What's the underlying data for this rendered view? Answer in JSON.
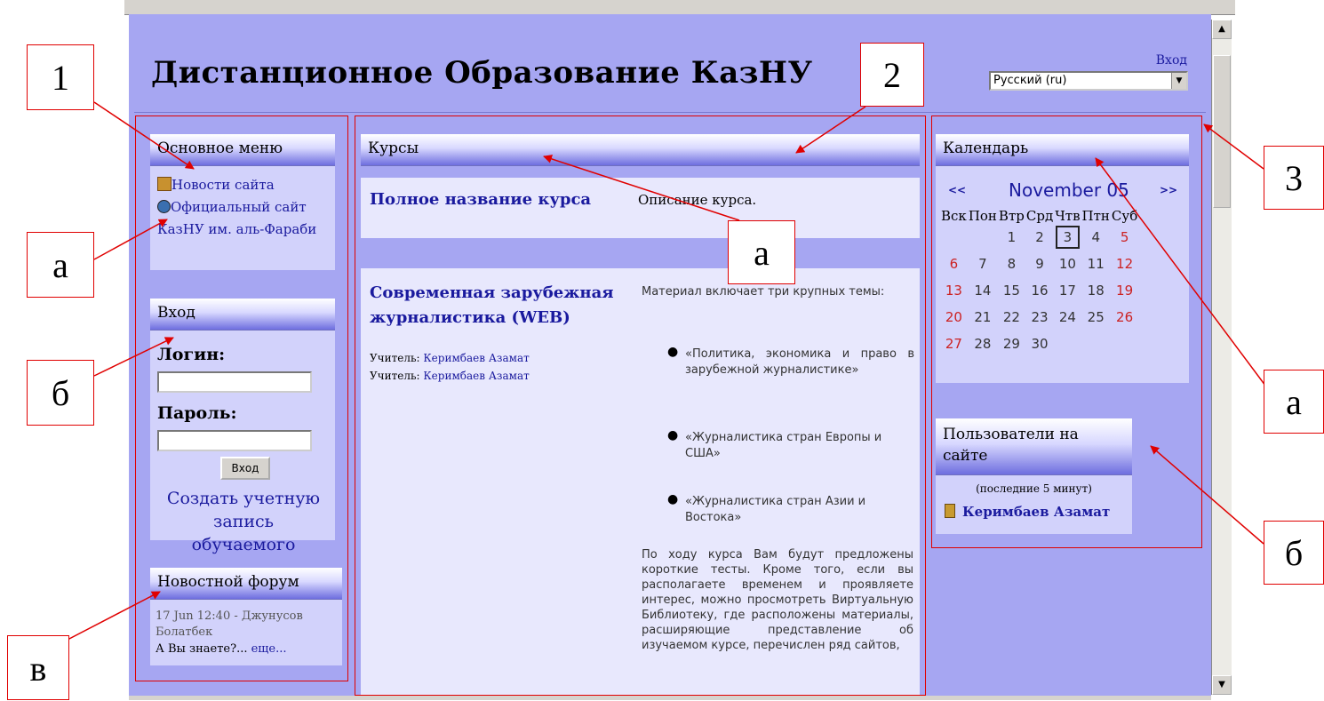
{
  "site": {
    "title": "Дистанционное Образование КазНУ",
    "login_link": "Вход",
    "language": "Русский (ru)"
  },
  "main_menu": {
    "title": "Основное меню",
    "items": [
      {
        "label": "Новости сайта",
        "icon": "news-icon"
      },
      {
        "label": "Официальный сайт КазНУ им. аль-Фараби",
        "icon": "globe-icon"
      }
    ]
  },
  "login_block": {
    "title": "Вход",
    "login_label": "Логин:",
    "password_label": "Пароль:",
    "button": "Вход",
    "signup_link": "Создать учетную запись обучаемого"
  },
  "news_forum": {
    "title": "Новостной форум",
    "post_meta": "17 Jun 12:40 - Джунусов Болатбек",
    "post_text": "А Вы знаете?...",
    "more": "еще..."
  },
  "courses": {
    "title": "Курсы",
    "list": [
      {
        "name": "Полное название курса",
        "description": "Описание курса."
      },
      {
        "name": "Современная зарубежная журналистика (WEB)",
        "teacher_label": "Учитель:",
        "teachers": [
          "Керимбаев Азамат",
          "Керимбаев Азамат"
        ],
        "intro": "Материал включает три крупных темы:",
        "topics": [
          "«Политика, экономика и право в зарубежной журналистике»",
          "«Журналистика стран Европы и США»",
          "«Журналистика стран Азии и Востока»"
        ],
        "body": "По ходу курса Вам будут предложены короткие тесты. Кроме того, если вы располагаете временем и проявляете интерес, можно просмотреть Виртуальную Библиотеку, где расположены материалы, расширяющие представление об изучаемом курсе, перечислен ряд сайтов,"
      }
    ]
  },
  "calendar": {
    "title": "Календарь",
    "prev": "<<",
    "next": ">>",
    "month": "November 05",
    "weekdays": [
      "Вск",
      "Пон",
      "Втр",
      "Срд",
      "Чтв",
      "Птн",
      "Суб"
    ],
    "weeks": [
      [
        "",
        "",
        "1",
        "2",
        "3",
        "4",
        "5"
      ],
      [
        "6",
        "7",
        "8",
        "9",
        "10",
        "11",
        "12"
      ],
      [
        "13",
        "14",
        "15",
        "16",
        "17",
        "18",
        "19"
      ],
      [
        "20",
        "21",
        "22",
        "23",
        "24",
        "25",
        "26"
      ],
      [
        "27",
        "28",
        "29",
        "30",
        "",
        "",
        ""
      ]
    ],
    "today": "3",
    "weekend_color": "#cc2222"
  },
  "online_users": {
    "title": "Пользователи на сайте",
    "period": "(последние 5 минут)",
    "users": [
      "Керимбаев Азамат"
    ]
  },
  "annotations": {
    "region_1": "1",
    "region_2": "2",
    "region_3": "3",
    "a": "а",
    "b": "б",
    "v": "в"
  },
  "colors": {
    "page_bg": "#a6a6f2",
    "block_bg": "#d2d2fb",
    "link": "#1a1a9e",
    "annotation": "#e00000"
  }
}
